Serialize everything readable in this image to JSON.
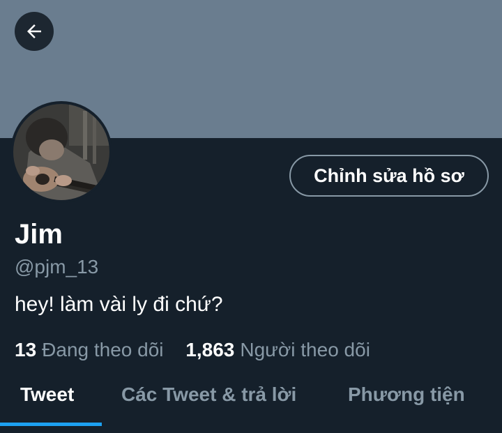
{
  "header": {
    "back_icon": "arrow-left-icon",
    "banner_color": "#6a7d8f"
  },
  "profile": {
    "avatar": "profile-photo-guitar",
    "edit_button_label": "Chỉnh sửa hồ sơ",
    "name": "Jim",
    "handle": "@pjm_13",
    "bio": "hey! làm vài ly đi chứ?"
  },
  "stats": {
    "following_count": "13",
    "following_label": "Đang theo dõi",
    "followers_count": "1,863",
    "followers_label": "Người theo dõi"
  },
  "tabs": [
    {
      "label": "Tweet",
      "active": true
    },
    {
      "label": "Các Tweet & trả lời",
      "active": false
    },
    {
      "label": "Phương tiện",
      "active": false
    }
  ],
  "colors": {
    "background": "#15202b",
    "accent": "#1da1f2",
    "secondary_text": "#8899a6"
  }
}
